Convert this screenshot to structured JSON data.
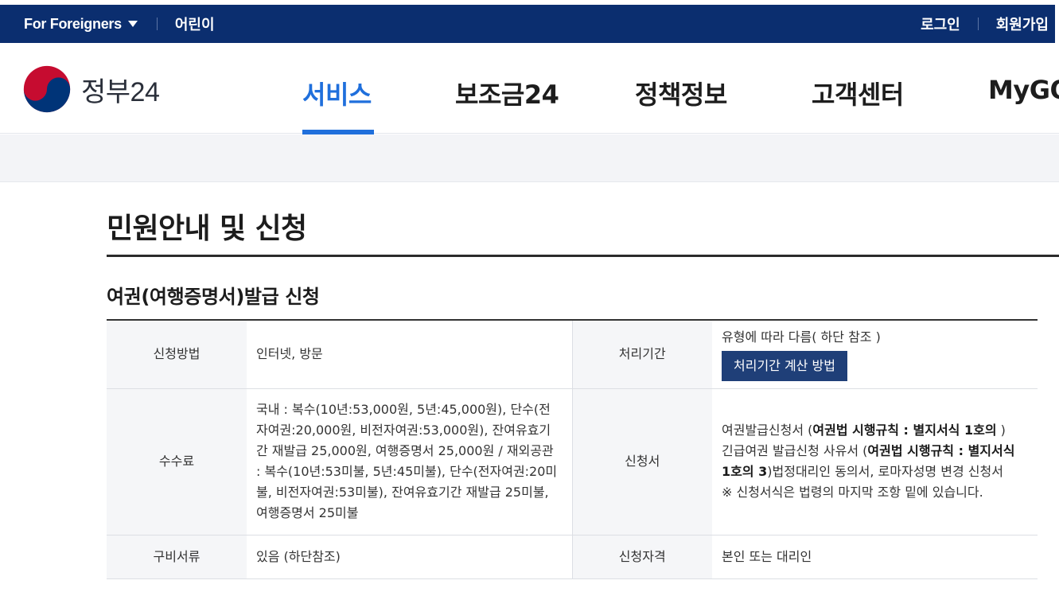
{
  "topbar": {
    "foreigners": "For Foreigners",
    "kids": "어린이",
    "login": "로그인",
    "signup": "회원가입"
  },
  "header": {
    "logo_text": "정부24",
    "nav": [
      "서비스",
      "보조금24",
      "정책정보",
      "고객센터",
      "MyGOV"
    ]
  },
  "page": {
    "title": "민원안내 및 신청",
    "section_title": "여권(여행증명서)발급 신청"
  },
  "table": {
    "method_label": "신청방법",
    "method_value": "인터넷, 방문",
    "period_label": "처리기간",
    "period_value": "유형에 따라 다름( 하단 참조 )",
    "period_button": "처리기간 계산 방법",
    "fee_label": "수수료",
    "fee_value": "국내 : 복수(10년:53,000원, 5년:45,000원), 단수(전자여권:20,000원, 비전자여권:53,000원), 잔여유효기간 재발급 25,000원, 여행증명서 25,000원 / 재외공관 : 복수(10년:53미불, 5년:45미불), 단수(전자여권:20미불, 비전자여권:53미불), 잔여유효기간 재발급 25미불, 여행증명서 25미불",
    "form_label": "신청서",
    "form_line1_pre": "여권발급신청서 (",
    "form_line1_bold": "여권법 시행규칙 : 별지서식 1호의",
    "form_line1_post": " )",
    "form_line2_pre": "긴급여권 발급신청 사유서 (",
    "form_line2_bold": "여권법 시행규칙 : 별지서식 1호의 3",
    "form_line2_post": ")법정대리인 동의서, 로마자성명 변경 신청서",
    "form_note": "※ 신청서식은 법령의 마지막 조항 밑에 있습니다.",
    "docs_label": "구비서류",
    "docs_value": "있음 (하단참조)",
    "eligibility_label": "신청자격",
    "eligibility_value": "본인 또는 대리인"
  }
}
